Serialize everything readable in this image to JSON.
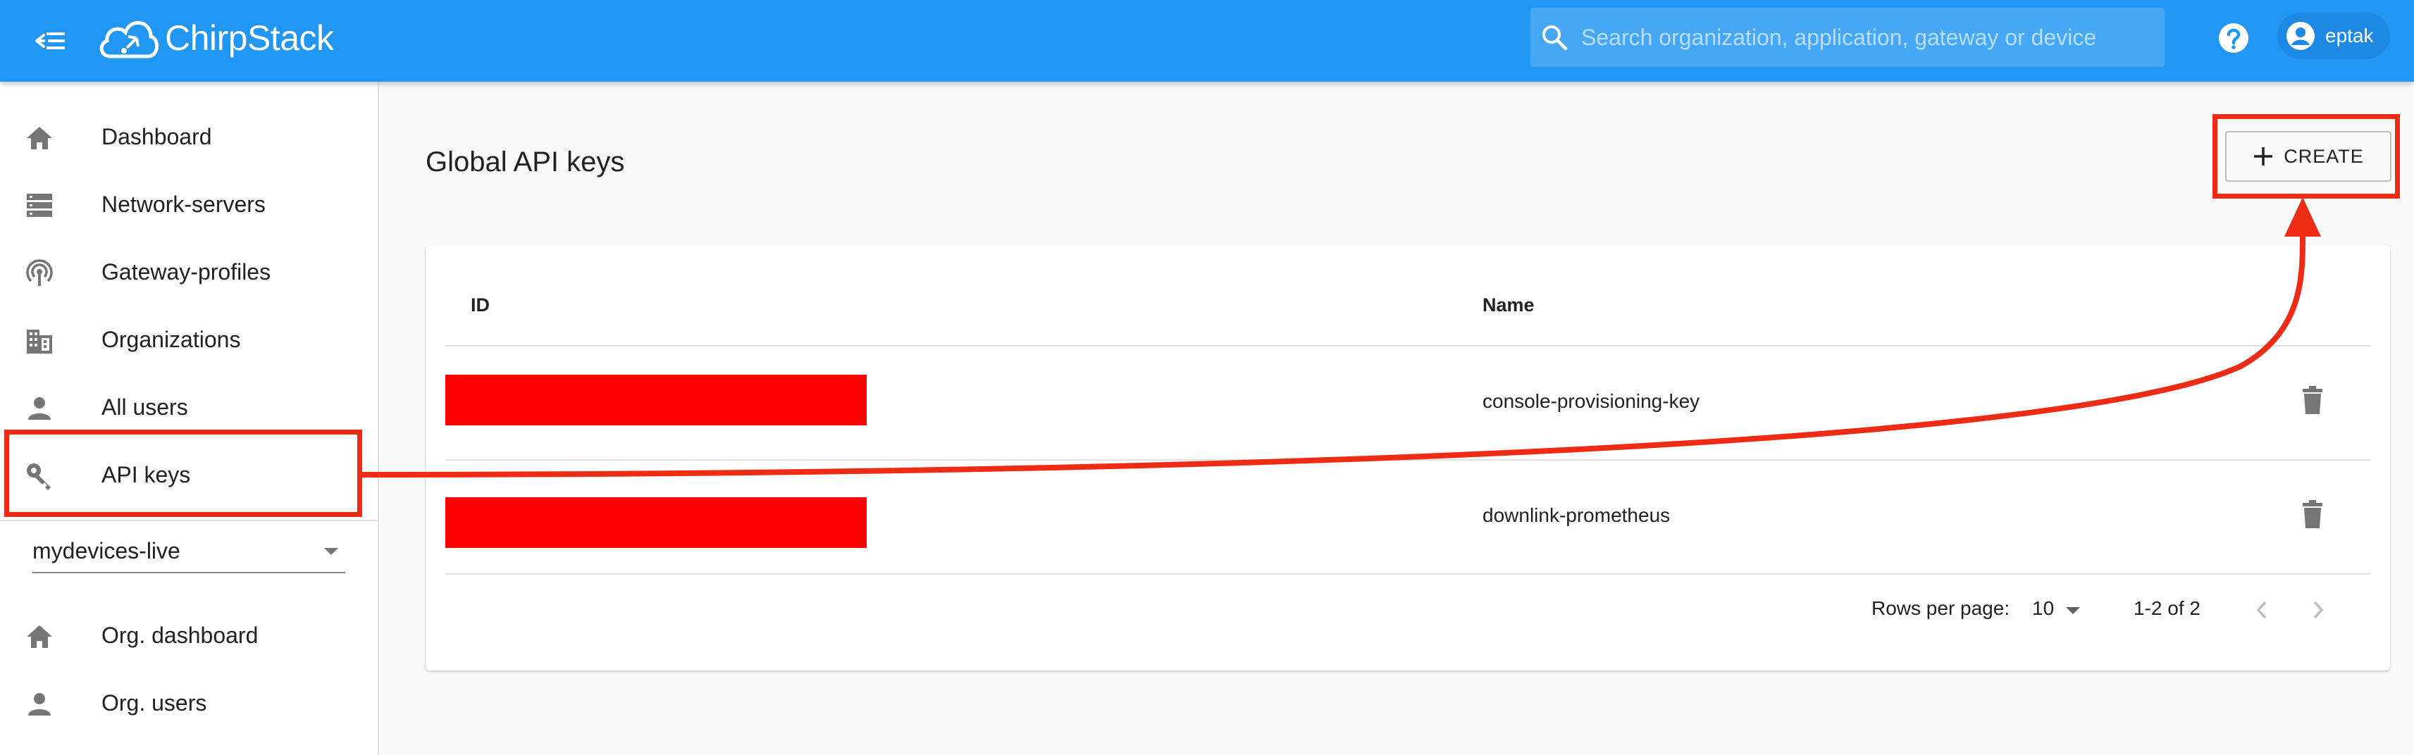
{
  "app": {
    "name": "ChirpStack"
  },
  "header": {
    "search_placeholder": "Search organization, application, gateway or device",
    "user": "eptak"
  },
  "sidebar": {
    "items": [
      {
        "label": "Dashboard",
        "icon": "home-icon"
      },
      {
        "label": "Network-servers",
        "icon": "server-icon"
      },
      {
        "label": "Gateway-profiles",
        "icon": "radio-tower-icon"
      },
      {
        "label": "Organizations",
        "icon": "domain-icon"
      },
      {
        "label": "All users",
        "icon": "person-icon"
      },
      {
        "label": "API keys",
        "icon": "key-icon"
      }
    ],
    "organization_selected": "mydevices-live",
    "org_items": [
      {
        "label": "Org. dashboard",
        "icon": "home-icon"
      },
      {
        "label": "Org. users",
        "icon": "person-icon"
      }
    ]
  },
  "main": {
    "title": "Global API keys",
    "create_label": "CREATE",
    "table": {
      "columns": [
        "ID",
        "Name"
      ],
      "rows": [
        {
          "id_redacted": true,
          "name": "console-provisioning-key"
        },
        {
          "id_redacted": true,
          "name": "downlink-prometheus"
        }
      ]
    },
    "pagination": {
      "rows_per_page_label": "Rows per page:",
      "rows_per_page": "10",
      "range": "1-2 of 2"
    }
  },
  "colors": {
    "primary": "#2196f3",
    "annotation": "#ee2b15",
    "redaction": "#ff0000"
  }
}
